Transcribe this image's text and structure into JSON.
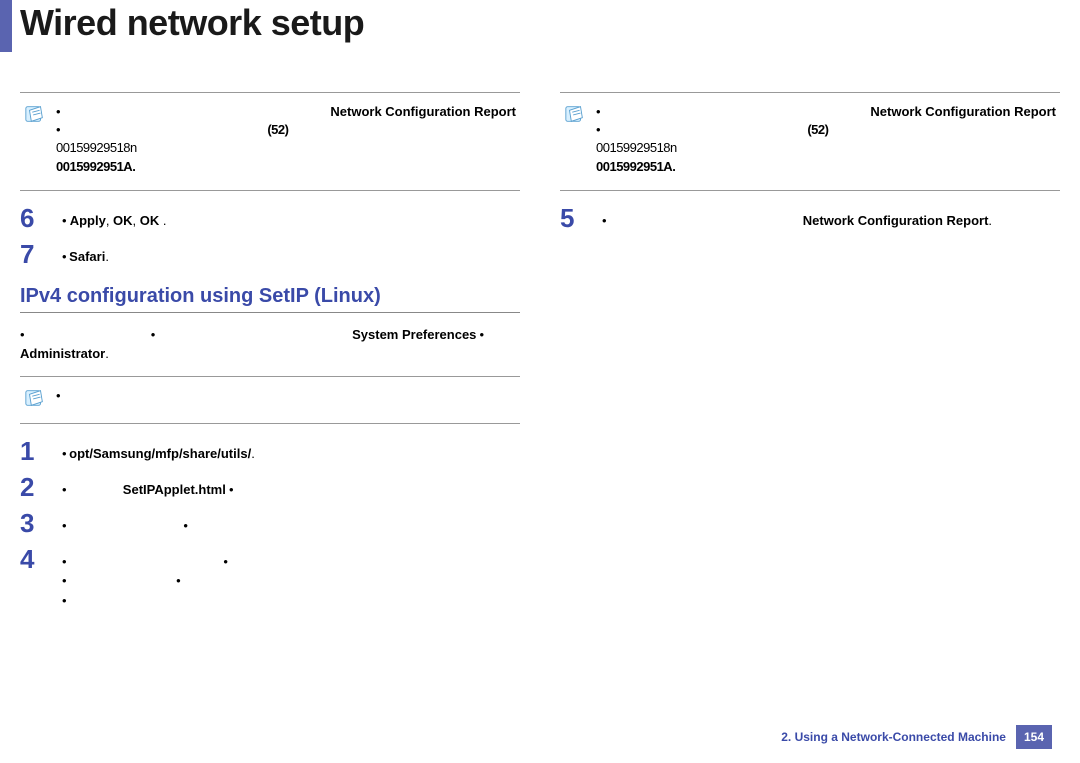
{
  "title": "Wired network setup",
  "left": {
    "note": {
      "line1_bold": "Network Configuration Report",
      "line1_pre": "•",
      "line2_a": "•",
      "line2_b": "(52)",
      "line3": "00159929518n",
      "line4": "0015992951A."
    },
    "step6": {
      "num": "6",
      "text_pre": "•",
      "bold1": "Apply",
      "mid": ", ",
      "bold2": "OK",
      "mid2": ", ",
      "bold3": "OK",
      "tail": " ."
    },
    "step7": {
      "num": "7",
      "text_pre": "• ",
      "bold": "Safari",
      "tail": "."
    },
    "section_heading": "IPv4 configuration using SetIP (Linux)",
    "intro_pre": "• ",
    "intro_bold1": "System Preferences",
    "intro_mid": " • ",
    "intro_bold2": "Administrator",
    "intro_tail": ".",
    "note2_line": "•",
    "step1": {
      "num": "1",
      "pre": "• ",
      "bold": "opt/Samsung/mfp/share/utils/",
      "tail": "."
    },
    "step2": {
      "num": "2",
      "pre": "• ",
      "bold": "SetIPApplet.html",
      "tail": " •"
    },
    "step3": {
      "num": "3",
      "pre": "•",
      "tail": " •"
    },
    "step4": {
      "num": "4",
      "pre": "•",
      "mid": " •",
      "tail": " •\n• •\n•"
    }
  },
  "right": {
    "note": {
      "line1_bold": "Network Configuration Report",
      "line1_pre": "•",
      "line2_a": "•",
      "line2_b": "(52)",
      "line3": "00159929518n",
      "line4": "0015992951A."
    },
    "step5": {
      "num": "5",
      "pre": "• ",
      "bold": "Network Configuration Report",
      "tail": "."
    }
  },
  "footer": {
    "chapter": "2.  Using a Network-Connected Machine",
    "page": "154"
  }
}
